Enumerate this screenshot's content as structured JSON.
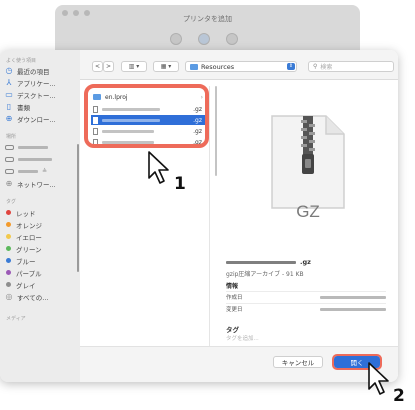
{
  "background_window": {
    "title": "プリンタを追加"
  },
  "sidebar": {
    "favorites_header": "よく使う項目",
    "favorites": [
      {
        "label": "最近の項目",
        "icon": "clock-icon"
      },
      {
        "label": "アプリケー...",
        "icon": "apps-icon"
      },
      {
        "label": "デスクトー...",
        "icon": "desktop-icon"
      },
      {
        "label": "書類",
        "icon": "document-icon"
      },
      {
        "label": "ダウンロー...",
        "icon": "download-icon"
      }
    ],
    "locations_header": "場所",
    "locations": [
      {
        "icon": "disk-icon"
      },
      {
        "icon": "disk-icon"
      },
      {
        "icon": "disk-icon",
        "eject": "≜"
      },
      {
        "label": "ネットワー...",
        "icon": "network-icon"
      }
    ],
    "tags_header": "タグ",
    "tags": [
      {
        "label": "レッド",
        "color": "#e0443e"
      },
      {
        "label": "オレンジ",
        "color": "#f39a2b"
      },
      {
        "label": "イエロー",
        "color": "#f2c94c"
      },
      {
        "label": "グリーン",
        "color": "#5cb85c"
      },
      {
        "label": "ブルー",
        "color": "#3a7bd5"
      },
      {
        "label": "パープル",
        "color": "#9b59b6"
      },
      {
        "label": "グレイ",
        "color": "#8e8e8e"
      },
      {
        "label": "すべての...",
        "icon": "all-tags-icon"
      }
    ],
    "media_header": "メディア"
  },
  "toolbar": {
    "back": "<",
    "forward": ">",
    "path_label": "Resources",
    "search_placeholder": "検索"
  },
  "files": [
    {
      "name": "en.lproj",
      "type": "folder",
      "chevron": "›"
    },
    {
      "ext": ".gz",
      "type": "file",
      "selected": false
    },
    {
      "ext": ".gz",
      "type": "file",
      "selected": true
    },
    {
      "ext": ".gz",
      "type": "file",
      "selected": false
    },
    {
      "ext": ".gz",
      "type": "file",
      "selected": false
    }
  ],
  "preview": {
    "icon_text": "GZ",
    "name_ext": ".gz",
    "kind": "gzip圧縮アーカイブ - 91 KB",
    "info_label": "情報",
    "created_label": "作成日",
    "modified_label": "変更日",
    "tags_label": "タグ",
    "tags_placeholder": "タグを追加..."
  },
  "buttons": {
    "cancel": "キャンセル",
    "open": "開く"
  },
  "callouts": [
    "1",
    "2"
  ]
}
